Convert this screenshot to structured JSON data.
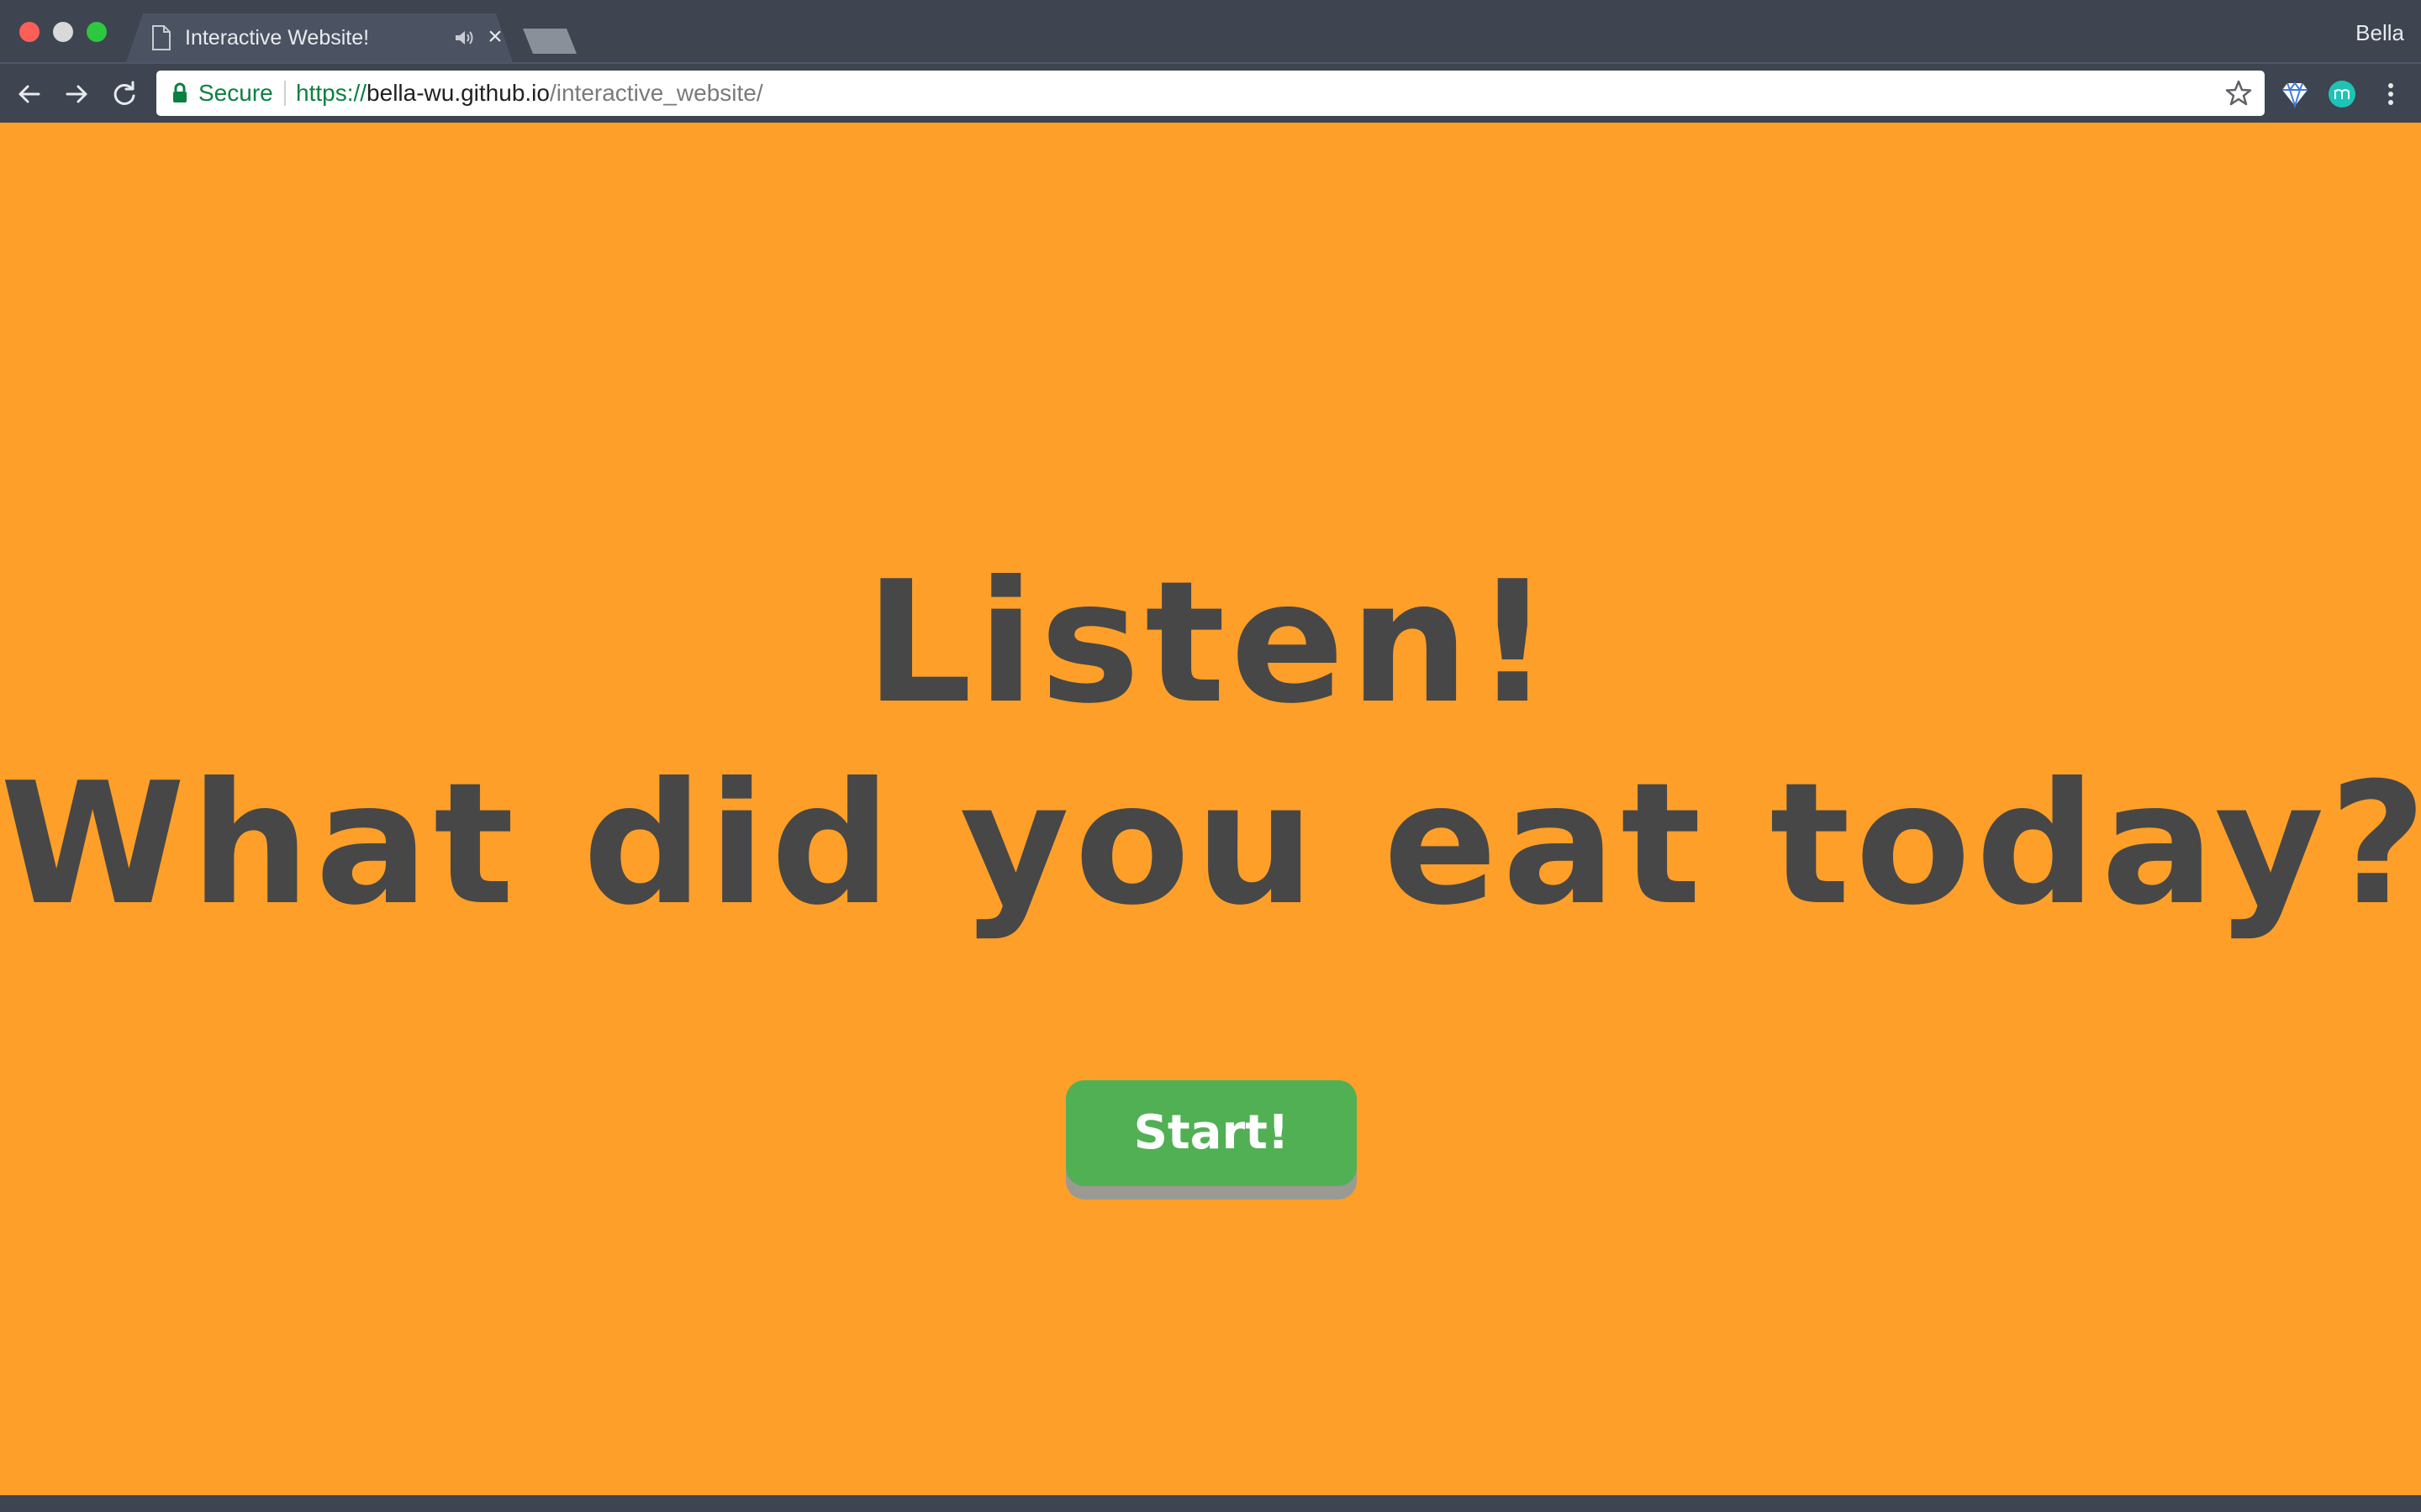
{
  "browser": {
    "tab": {
      "title": "Interactive Website!",
      "icon": "page-icon",
      "audio_icon": "speaker-icon",
      "close_glyph": "×"
    },
    "profile_name": "Bella",
    "address_bar": {
      "secure_label": "Secure",
      "url_scheme": "https://",
      "url_host": "bella-wu.github.io",
      "url_path": "/interactive_website/"
    },
    "colors": {
      "chrome": "#3e4450",
      "secure_green": "#0b8043"
    }
  },
  "page": {
    "headline_line1": "Listen!",
    "headline_line2": "What did you eat today?",
    "start_button_label": "Start!",
    "colors": {
      "background": "#fd9f29",
      "text": "#474747",
      "button": "#51b054"
    }
  }
}
